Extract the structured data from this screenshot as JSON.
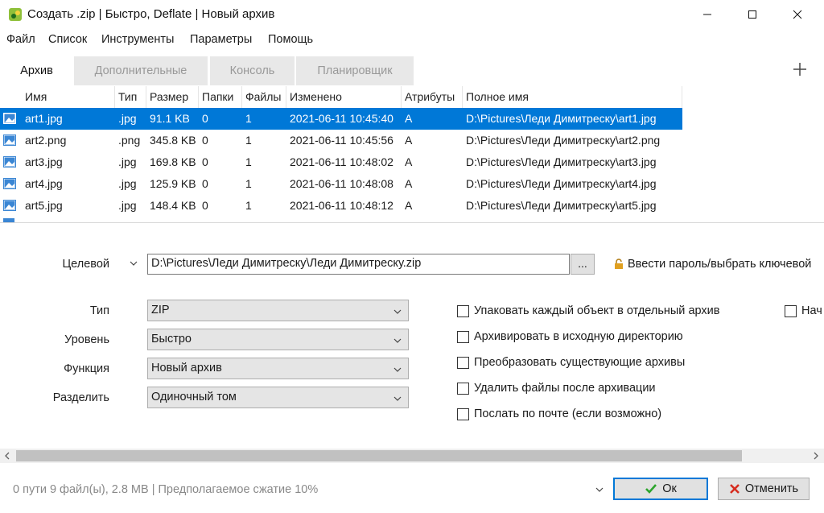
{
  "window": {
    "title": "Создать .zip | Быстро, Deflate | Новый архив"
  },
  "menu": [
    "Файл",
    "Список",
    "Инструменты",
    "Параметры",
    "Помощь"
  ],
  "tabs": [
    "Архив",
    "Дополнительные",
    "Консоль",
    "Планировщик"
  ],
  "list": {
    "columns": [
      "Имя",
      "Тип",
      "Размер",
      "Папки",
      "Файлы",
      "Изменено",
      "Атрибуты",
      "Полное имя"
    ],
    "rows": [
      {
        "name": "art1.jpg",
        "type": ".jpg",
        "size": "91.1 KB",
        "folders": "0",
        "files": "1",
        "modified": "2021-06-11 10:45:40",
        "attr": "A",
        "path": "D:\\Pictures\\Леди Димитреску\\art1.jpg"
      },
      {
        "name": "art2.png",
        "type": ".png",
        "size": "345.8 KB",
        "folders": "0",
        "files": "1",
        "modified": "2021-06-11 10:45:56",
        "attr": "A",
        "path": "D:\\Pictures\\Леди Димитреску\\art2.png"
      },
      {
        "name": "art3.jpg",
        "type": ".jpg",
        "size": "169.8 KB",
        "folders": "0",
        "files": "1",
        "modified": "2021-06-11 10:48:02",
        "attr": "A",
        "path": "D:\\Pictures\\Леди Димитреску\\art3.jpg"
      },
      {
        "name": "art4.jpg",
        "type": ".jpg",
        "size": "125.9 KB",
        "folders": "0",
        "files": "1",
        "modified": "2021-06-11 10:48:08",
        "attr": "A",
        "path": "D:\\Pictures\\Леди Димитреску\\art4.jpg"
      },
      {
        "name": "art5.jpg",
        "type": ".jpg",
        "size": "148.4 KB",
        "folders": "0",
        "files": "1",
        "modified": "2021-06-11 10:48:12",
        "attr": "A",
        "path": "D:\\Pictures\\Леди Димитреску\\art5.jpg"
      }
    ]
  },
  "form": {
    "target_label": "Целевой",
    "target_value": "D:\\Pictures\\Леди Димитреску\\Леди Димитреску.zip",
    "browse_label": "...",
    "password_label": "Ввести пароль/выбрать ключевой",
    "type_label": "Тип",
    "type_value": "ZIP",
    "level_label": "Уровень",
    "level_value": "Быстро",
    "function_label": "Функция",
    "function_value": "Новый архив",
    "split_label": "Разделить",
    "split_value": "Одиночный том"
  },
  "options": [
    "Упаковать каждый объект в отдельный архив",
    "Архивировать в исходную директорию",
    "Преобразовать существующие архивы",
    "Удалить файлы после архивации",
    "Послать по почте (если возможно)"
  ],
  "option_extra": "Нач",
  "status": {
    "text": "0 пути 9 файл(ы), 2.8 MB | Предполагаемое сжатие 10%"
  },
  "buttons": {
    "ok": "Ок",
    "cancel": "Отменить"
  },
  "colors": {
    "selection": "#0078d7",
    "ok_check": "#2da52d",
    "cancel_x": "#d62d20",
    "lock": "#e0a020"
  },
  "icons": [
    "app-icon",
    "minimize-icon",
    "maximize-icon",
    "close-icon",
    "plus-icon",
    "image-file-icon",
    "chevron-down-icon",
    "lock-icon",
    "check-icon",
    "x-icon"
  ]
}
